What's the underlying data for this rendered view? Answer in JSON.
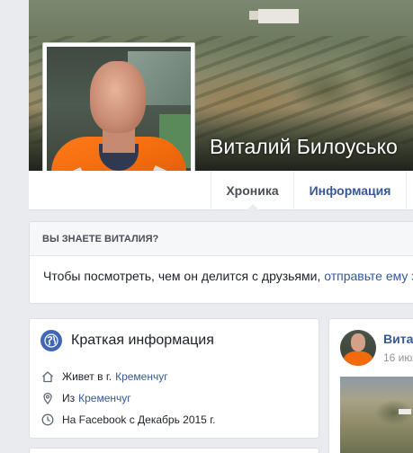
{
  "profile": {
    "name": "Виталий Билоусько"
  },
  "tabs": {
    "chronicle": "Хроника",
    "info": "Информация",
    "more": ""
  },
  "know_box": {
    "heading": "ВЫ ЗНАЕТЕ ВИТАЛИЯ?",
    "text": "Чтобы посмотреть, чем он делится с друзьями, ",
    "link": "отправьте ему з"
  },
  "brief": {
    "title": "Краткая информация",
    "lives_prefix": "Живет в г.",
    "lives_city": "Кременчуг",
    "from_prefix": "Из",
    "from_city": "Кременчуг",
    "since": "На Facebook с Декабрь 2015 г."
  },
  "post": {
    "author": "Вита",
    "date": "16 июл"
  },
  "colors": {
    "link": "#365899",
    "accent": "#4267b2",
    "background": "#e9ebee"
  }
}
